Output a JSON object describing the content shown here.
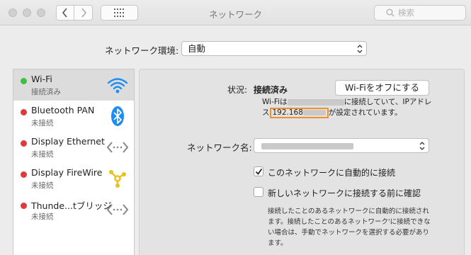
{
  "window": {
    "title": "ネットワーク"
  },
  "search": {
    "placeholder": "検索"
  },
  "location": {
    "label": "ネットワーク環境:",
    "value": "自動"
  },
  "services": [
    {
      "name": "Wi-Fi",
      "status": "接続済み",
      "status_color": "#3dc23f",
      "icon": "wifi-icon",
      "selected": true
    },
    {
      "name": "Bluetooth PAN",
      "status": "未接続",
      "status_color": "#e03a3e",
      "icon": "bluetooth-icon"
    },
    {
      "name": "Display Ethernet",
      "status": "未接続",
      "status_color": "#e03a3e",
      "icon": "ethernet-arrows-icon"
    },
    {
      "name": "Display FireWire",
      "status": "未接続",
      "status_color": "#e03a3e",
      "icon": "firewire-icon"
    },
    {
      "name": "Thunde...tブリッジ",
      "status": "未接続",
      "status_color": "#e03a3e",
      "icon": "thunderbolt-bridge-icon"
    }
  ],
  "detail": {
    "status_label": "状況:",
    "status_value": "接続済み",
    "wifi_off_button": "Wi-Fiをオフにする",
    "desc_prefix": "Wi-Fiは",
    "desc_middle": "に接続していて、IPアドレス",
    "ip_visible": "192.168",
    "desc_suffix": "が設定されています。",
    "network_name_label": "ネットワーク名:",
    "auto_join_label": "このネットワークに自動的に接続",
    "auto_join_checked": true,
    "ask_join_label": "新しいネットワークに接続する前に確認",
    "ask_join_checked": false,
    "help_text": "接続したことのあるネットワークに自動的に接続されます。接続したことのあるネットワーク'に接続できない場合は、手動でネットワークを選択する必要があります。"
  },
  "colors": {
    "highlight": "#f0922c",
    "connected": "#3dc23f",
    "disconnected": "#e03a3e",
    "wifi_blue": "#1e8cf0"
  }
}
